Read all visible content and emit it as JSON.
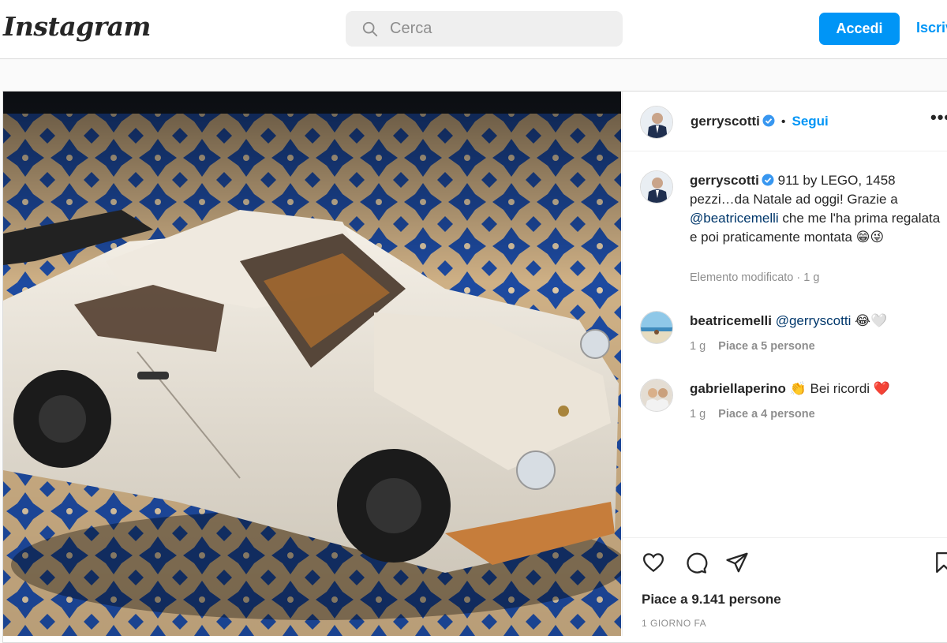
{
  "header": {
    "logo": "Instagram",
    "search_placeholder": "Cerca",
    "login_label": "Accedi",
    "signup_label": "Iscriviti"
  },
  "post": {
    "author": "gerryscotti",
    "follow_label": "Segui",
    "caption": "911 by LEGO, 1458 pezzi…da Natale ad oggi! Grazie a",
    "caption_mention": "@beatricemelli",
    "caption_rest": "che me l'ha prima regalata e poi praticamente montata",
    "caption_emoji": "😁😜",
    "caption_meta": "Elemento modificato · 1 g",
    "comments": [
      {
        "user": "beatricemelli",
        "mention": "@gerryscotti",
        "text": "😂🤍",
        "time": "1 g",
        "likes": "Piace a 5 persone"
      },
      {
        "user": "gabriellaperino",
        "mention": "",
        "text": "👏 Bei ricordi ❤️",
        "time": "1 g",
        "likes": "Piace a 4 persone"
      }
    ],
    "likes_count": "Piace a 9.141 persone",
    "date": "1 GIORNO FA"
  },
  "colors": {
    "accent": "#0095f6",
    "text": "#262626",
    "muted": "#8e8e8e"
  }
}
